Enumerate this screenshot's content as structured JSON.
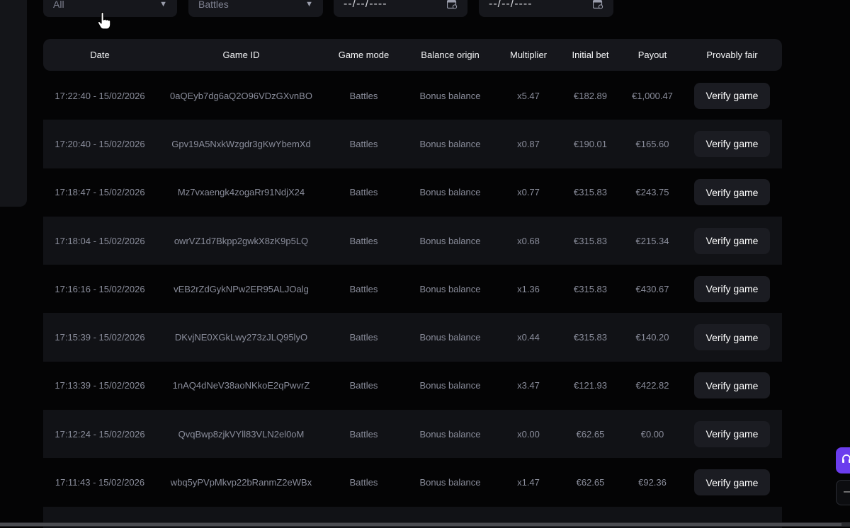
{
  "filters": {
    "mode_value": "All",
    "game_value": "Battles",
    "date_from": "--/--/----",
    "date_to": "--/--/----"
  },
  "table": {
    "headers": [
      "Date",
      "Game ID",
      "Game mode",
      "Balance origin",
      "Multiplier",
      "Initial bet",
      "Payout",
      "Provably fair"
    ],
    "verify_label": "Verify game",
    "rows": [
      {
        "date": "17:22:40 - 15/02/2026",
        "game_id": "0aQEyb7dg6aQ2O96VDzGXvnBO",
        "mode": "Battles",
        "origin": "Bonus balance",
        "multiplier": "x5.47",
        "bet": "€182.89",
        "payout": "€1,000.47"
      },
      {
        "date": "17:20:40 - 15/02/2026",
        "game_id": "Gpv19A5NxkWzgdr3gKwYbemXd",
        "mode": "Battles",
        "origin": "Bonus balance",
        "multiplier": "x0.87",
        "bet": "€190.01",
        "payout": "€165.60"
      },
      {
        "date": "17:18:47 - 15/02/2026",
        "game_id": "Mz7vxaengk4zogaRr91NdjX24",
        "mode": "Battles",
        "origin": "Bonus balance",
        "multiplier": "x0.77",
        "bet": "€315.83",
        "payout": "€243.75"
      },
      {
        "date": "17:18:04 - 15/02/2026",
        "game_id": "owrVZ1d7Bkpp2gwkX8zK9p5LQ",
        "mode": "Battles",
        "origin": "Bonus balance",
        "multiplier": "x0.68",
        "bet": "€315.83",
        "payout": "€215.34"
      },
      {
        "date": "17:16:16 - 15/02/2026",
        "game_id": "vEB2rZdGykNPw2ER95ALJOalg",
        "mode": "Battles",
        "origin": "Bonus balance",
        "multiplier": "x1.36",
        "bet": "€315.83",
        "payout": "€430.67"
      },
      {
        "date": "17:15:39 - 15/02/2026",
        "game_id": "DKvjNE0XGkLwy273zJLQ95lyO",
        "mode": "Battles",
        "origin": "Bonus balance",
        "multiplier": "x0.44",
        "bet": "€315.83",
        "payout": "€140.20"
      },
      {
        "date": "17:13:39 - 15/02/2026",
        "game_id": "1nAQ4dNeV38aoNKkoE2qPwvrZ",
        "mode": "Battles",
        "origin": "Bonus balance",
        "multiplier": "x3.47",
        "bet": "€121.93",
        "payout": "€422.82"
      },
      {
        "date": "17:12:24 - 15/02/2026",
        "game_id": "QvqBwp8zjkVYll83VLN2el0oM",
        "mode": "Battles",
        "origin": "Bonus balance",
        "multiplier": "x0.00",
        "bet": "€62.65",
        "payout": "€0.00"
      },
      {
        "date": "17:11:43 - 15/02/2026",
        "game_id": "wbq5yPVpMkvp22bRanmZ2eWBx",
        "mode": "Battles",
        "origin": "Bonus balance",
        "multiplier": "x1.47",
        "bet": "€62.65",
        "payout": "€92.36"
      }
    ]
  },
  "colors": {
    "background": "#040405",
    "panel": "#16171c",
    "row_alt": "#111216",
    "accent": "#6b3dee"
  },
  "icons": {
    "filter_caret": "caret-down-icon",
    "date_picker": "calendar-icon",
    "support": "headset-icon",
    "scroll_top": "arrow-icon"
  }
}
